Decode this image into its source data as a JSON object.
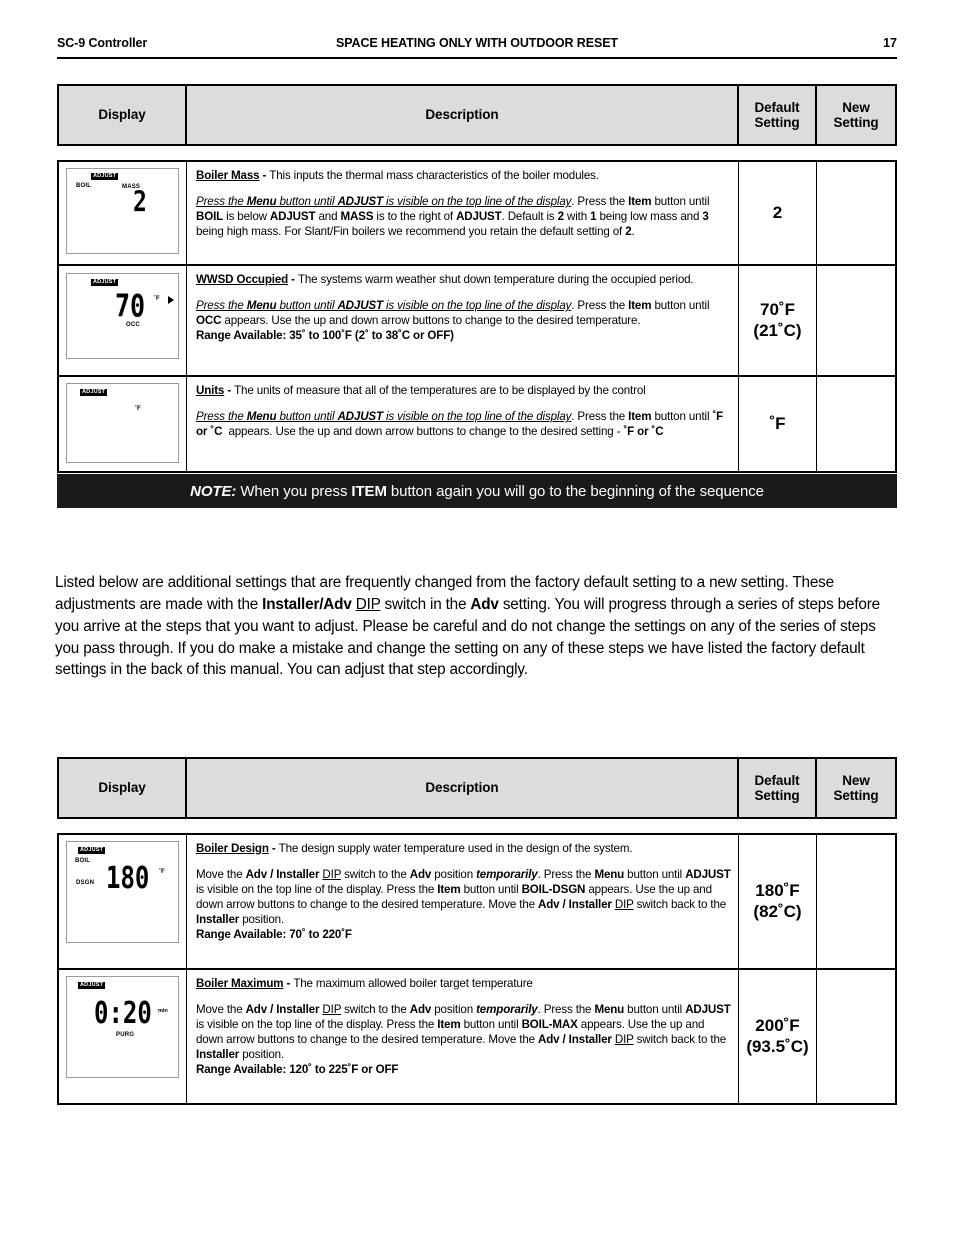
{
  "header": {
    "left": "SC-9 Controller",
    "center": "SPACE HEATING ONLY WITH OUTDOOR RESET",
    "page_number": "17"
  },
  "table_headers": {
    "display": "Display",
    "description": "Description",
    "default_setting_line1": "Default",
    "default_setting_line2": "Setting",
    "new_setting_line1": "New",
    "new_setting_line2": "Setting"
  },
  "table1": {
    "rows": [
      {
        "lcd": {
          "badge": "ADJUST",
          "label_left": "BOIL",
          "label_right": "MASS",
          "value": "2",
          "unit": "",
          "sublabel": ""
        },
        "title": "Boiler Mass",
        "title_sep": " - ",
        "lead": "This inputs the thermal mass characteristics of the boiler modules.",
        "instr_italic": "Press the Menu button until ADJUST is visible on the top line of the display.",
        "instr_rest": " Press the Item button until BOIL is below ADJUST and MASS is to the right of ADJUST. Default is 2 with 1 being low mass and 3 being high mass. For Slant/Fin boilers we recommend you retain the default setting of 2.",
        "range": "",
        "default_line1": "2",
        "default_line2": "",
        "new_setting": ""
      },
      {
        "lcd": {
          "badge": "ADJUST",
          "label_left": "",
          "label_right": "",
          "value": "70",
          "unit": "˚F",
          "sublabel": "OCC"
        },
        "title": "WWSD Occupied",
        "title_sep": " - ",
        "lead": "The systems warm weather shut down temperature during the occupied period.",
        "instr_italic": "Press the Menu button until ADJUST is visible on the top line of the display.",
        "instr_rest": " Press the Item button until OCC appears. Use the up and down arrow buttons to change to the desired temperature.",
        "range": "Range Available: 35˚ to 100˚F (2˚ to 38˚C or OFF)",
        "default_line1": "70˚F",
        "default_line2": "(21˚C)",
        "new_setting": ""
      },
      {
        "lcd": {
          "badge": "ADJUST",
          "label_left": "",
          "label_right": "",
          "value": "",
          "unit": "˚F",
          "sublabel": ""
        },
        "title": "Units",
        "title_sep": " - ",
        "lead": "The units of measure that all of the temperatures are to be displayed by the control",
        "instr_italic": "Press the Menu button until ADJUST is visible on the top line of the display.",
        "instr_rest": " Press the Item button until ˚F or ˚C  appears. Use the up and down arrow buttons to change to the desired setting - ˚F or ˚C",
        "range": "",
        "default_line1": "˚F",
        "default_line2": "",
        "new_setting": ""
      }
    ]
  },
  "note": {
    "label": "NOTE:",
    "text": " When you press ITEM button again you will go to the beginning of the sequence",
    "bold_word": "ITEM"
  },
  "body_paragraph": "Listed below are additional settings that are frequently changed from the factory default setting to a new setting. These adjustments are made with the Installer/Adv DIP switch in the Adv setting. You will progress through a series of steps before you arrive at the steps that you want to adjust. Please be careful and do not change the settings on any of the series of steps you pass through. If you do make a mistake and change the setting on any of these steps we have listed the factory default settings in the back of this manual. You can adjust that step accordingly.",
  "table2": {
    "rows": [
      {
        "lcd": {
          "badge": "ADJUST",
          "label_left": "BOIL",
          "label_left2": "DSGN",
          "value": "180",
          "unit": "˚F",
          "sublabel": ""
        },
        "title": "Boiler Design",
        "title_sep": " - ",
        "lead": "The design supply water temperature used in the design of the system.",
        "instr": "Move the Adv / Installer DIP switch to the Adv position temporarily. Press the Menu button until ADJUST is visible on the top line of the display. Press the Item button until BOIL-DSGN appears. Use the up and down arrow buttons to change to the desired temperature. Move the Adv / Installer DIP switch back to the Installer position.",
        "range": "Range Available: 70˚ to 220˚F",
        "default_line1": "180˚F",
        "default_line2": "(82˚C)",
        "new_setting": ""
      },
      {
        "lcd": {
          "badge": "ADJUST",
          "label_left": "",
          "label_left2": "",
          "value": "0:20",
          "unit": "min",
          "sublabel": "PURG"
        },
        "title": "Boiler Maximum",
        "title_sep": " - ",
        "lead": "The maximum allowed boiler target temperature",
        "instr": "Move the Adv / Installer DIP switch to the Adv position temporarily. Press the Menu button until ADJUST is visible on the top line of the display. Press the Item button until BOIL-MAX appears. Use the up and down arrow buttons to change to the desired temperature. Move the Adv / Installer DIP switch back to the Installer position.",
        "range": "Range Available: 120˚ to 225˚F or OFF",
        "default_line1": "200˚F",
        "default_line2": "(93.5˚C)",
        "new_setting": ""
      }
    ]
  },
  "colors": {
    "header_fill": "#dcdcdc",
    "note_bg": "#1a1a1a",
    "note_fg": "#ffffff",
    "border": "#000000"
  }
}
